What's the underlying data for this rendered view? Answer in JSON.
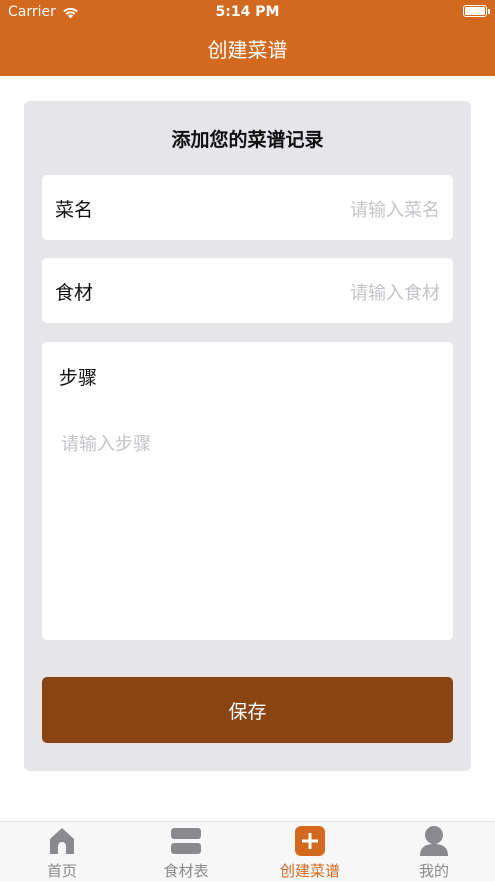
{
  "status_bar": {
    "carrier": "Carrier",
    "time": "5:14 PM"
  },
  "nav": {
    "title": "创建菜谱"
  },
  "form": {
    "heading": "添加您的菜谱记录",
    "dish_name": {
      "label": "菜名",
      "placeholder": "请输入菜名"
    },
    "ingredients": {
      "label": "食材",
      "placeholder": "请输入食材"
    },
    "steps": {
      "label": "步骤",
      "placeholder": "请输入步骤"
    },
    "save_label": "保存"
  },
  "tabs": [
    {
      "label": "首页",
      "icon": "home-icon"
    },
    {
      "label": "食材表",
      "icon": "list-icon"
    },
    {
      "label": "创建菜谱",
      "icon": "plus-icon"
    },
    {
      "label": "我的",
      "icon": "person-icon"
    }
  ],
  "active_tab": "创建菜谱",
  "colors": {
    "brand": "#d2691e",
    "save_button": "#8b4513",
    "card_background": "#e6e5ea",
    "tab_inactive": "#8a8a8e"
  }
}
